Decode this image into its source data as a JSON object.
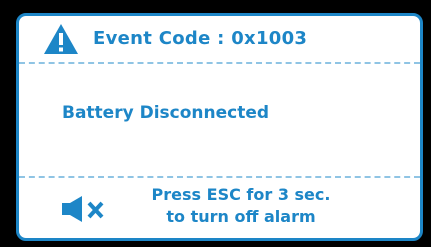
{
  "dialog": {
    "event_code_label": "Event Code :  0x1003",
    "message": "Battery Disconnected",
    "alarm_hint": {
      "line1": "Press ESC for 3 sec.",
      "line2": "to turn off alarm"
    }
  },
  "icons": {
    "warning": "warning-triangle-icon",
    "mute": "speaker-mute-icon"
  },
  "colors": {
    "accent": "#1d86c7",
    "divider": "#8fc4e4",
    "background": "#ffffff",
    "outer": "#000000"
  }
}
